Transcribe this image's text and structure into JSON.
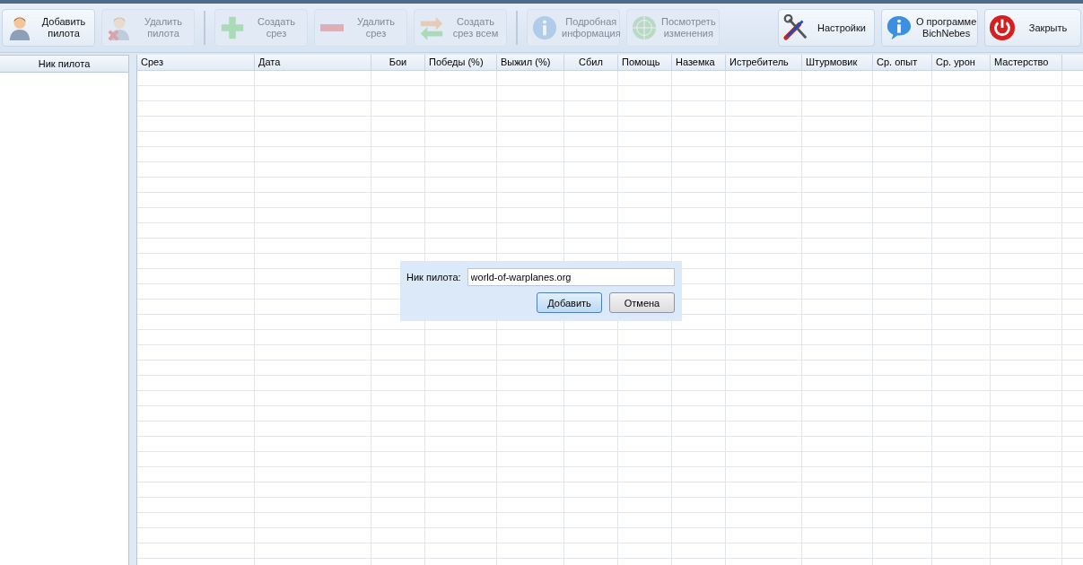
{
  "toolbar": {
    "left_groups": [
      [
        {
          "label": "Добавить\nпилота",
          "disabled": false
        },
        {
          "label": "Удалить\nпилота",
          "disabled": true
        }
      ],
      [
        {
          "label": "Создать\nсрез",
          "disabled": true
        },
        {
          "label": "Удалить\nсрез",
          "disabled": true
        },
        {
          "label": "Создать\nсрез всем",
          "disabled": true
        }
      ],
      [
        {
          "label": "Подробная\nинформация",
          "disabled": true
        },
        {
          "label": "Посмотреть\nизменения",
          "disabled": true
        }
      ]
    ],
    "right": [
      {
        "label": "Настройки",
        "disabled": false
      },
      {
        "label": "О программе\nBichNebes",
        "disabled": false
      },
      {
        "label": "Закрыть",
        "disabled": false
      }
    ]
  },
  "pilot_list": {
    "header": "Ник пилота"
  },
  "table": {
    "columns": [
      "Срез",
      "Дата",
      "Бои",
      "Победы (%)",
      "Выжил (%)",
      "Сбил",
      "Помощь",
      "Наземка",
      "Истребитель",
      "Штурмовик",
      "Ср. опыт",
      "Ср. урон",
      "Мастерство"
    ]
  },
  "dialog": {
    "label": "Ник пилота:",
    "value": "world-of-warplanes.org",
    "buttons": [
      {
        "label": "Добавить",
        "selected": true
      },
      {
        "label": "Отмена",
        "selected": false
      }
    ]
  }
}
